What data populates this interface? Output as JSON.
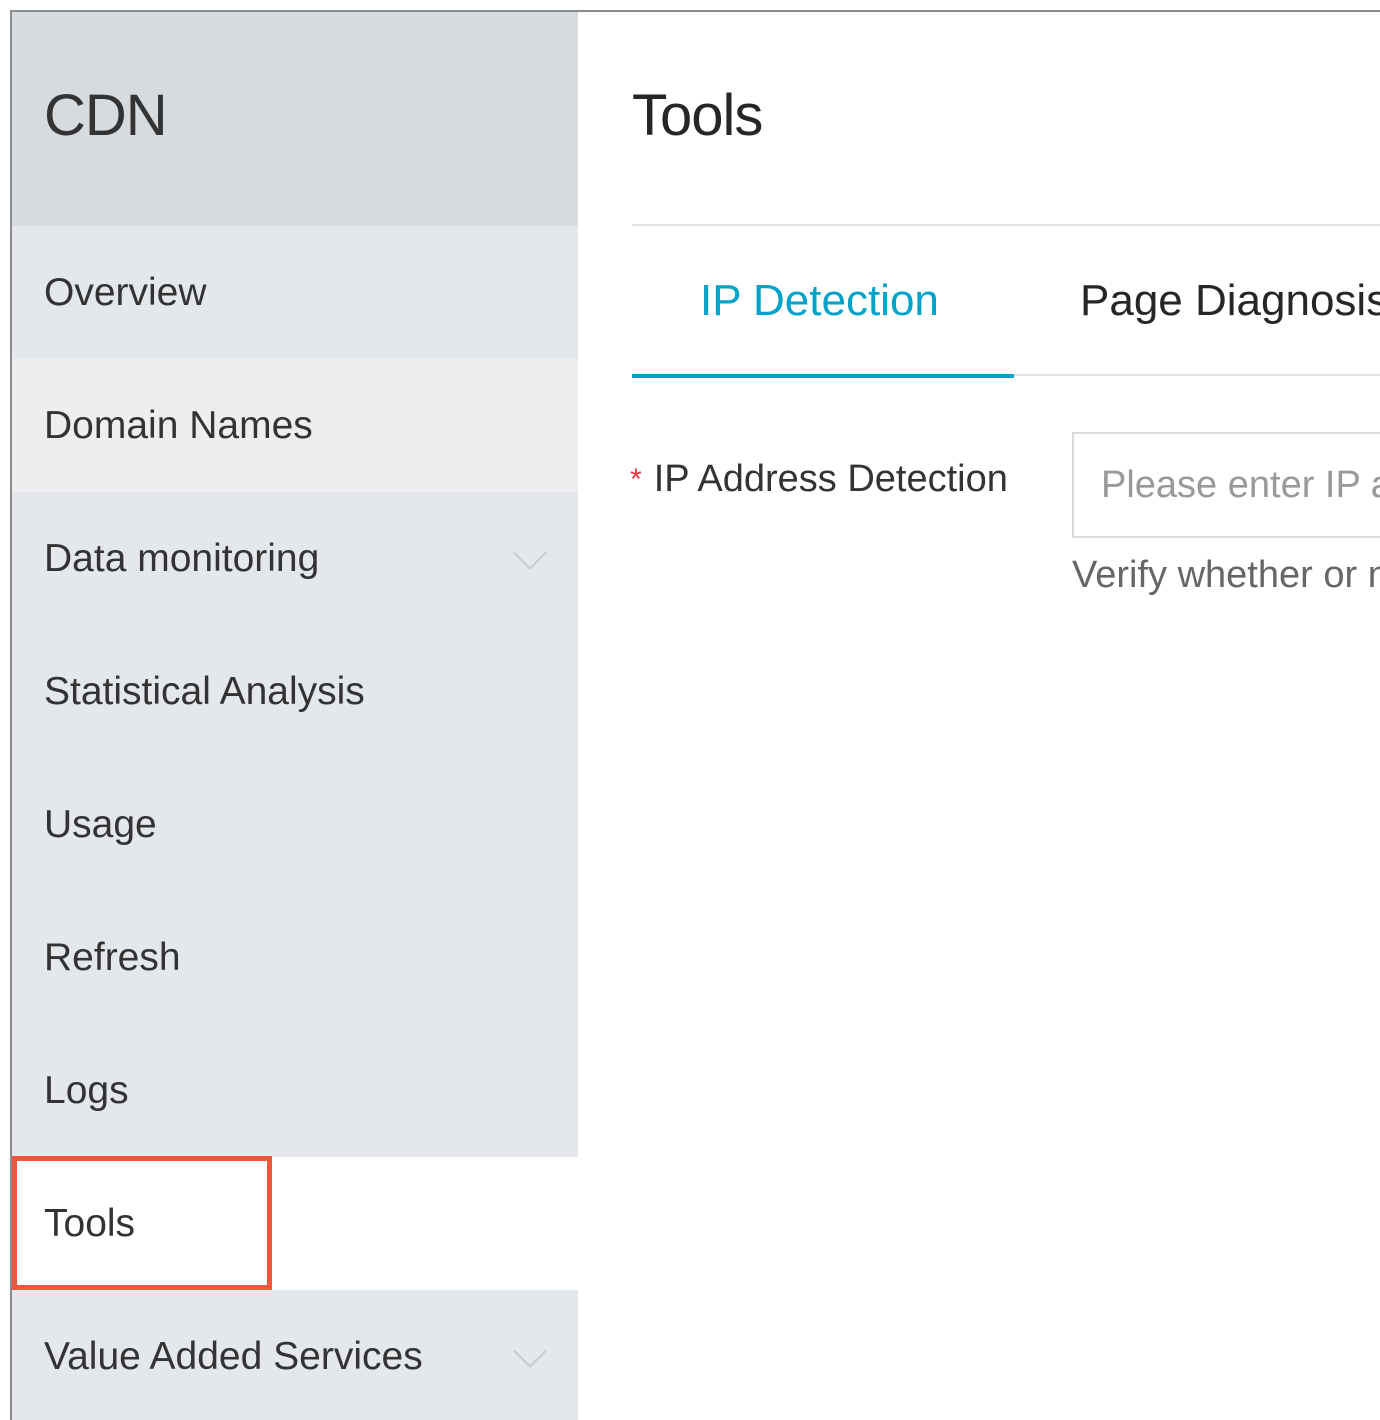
{
  "sidebar": {
    "title": "CDN",
    "items": [
      {
        "label": "Overview"
      },
      {
        "label": "Domain Names"
      },
      {
        "label": "Data monitoring"
      },
      {
        "label": "Statistical Analysis"
      },
      {
        "label": "Usage"
      },
      {
        "label": "Refresh"
      },
      {
        "label": "Logs"
      },
      {
        "label": "Tools"
      },
      {
        "label": "Value Added Services"
      }
    ],
    "selected": "Tools"
  },
  "main": {
    "title": "Tools",
    "tabs": [
      {
        "label": "IP Detection",
        "active": true
      },
      {
        "label": "Page Diagnosis"
      }
    ],
    "form": {
      "required_mark": "*",
      "label": "IP Address Detection",
      "input_placeholder": "Please enter IP address",
      "input_value": "",
      "help_text": "Verify whether or not the IP address belongs to a CDN node"
    }
  },
  "colors": {
    "accent": "#00a2ca",
    "highlight": "#f0553d",
    "required": "#e4393c",
    "sidebar_bg": "#e4e8ec",
    "sidebar_header_bg": "#d6dbe0"
  },
  "icons": [
    "chevron-down-icon"
  ]
}
